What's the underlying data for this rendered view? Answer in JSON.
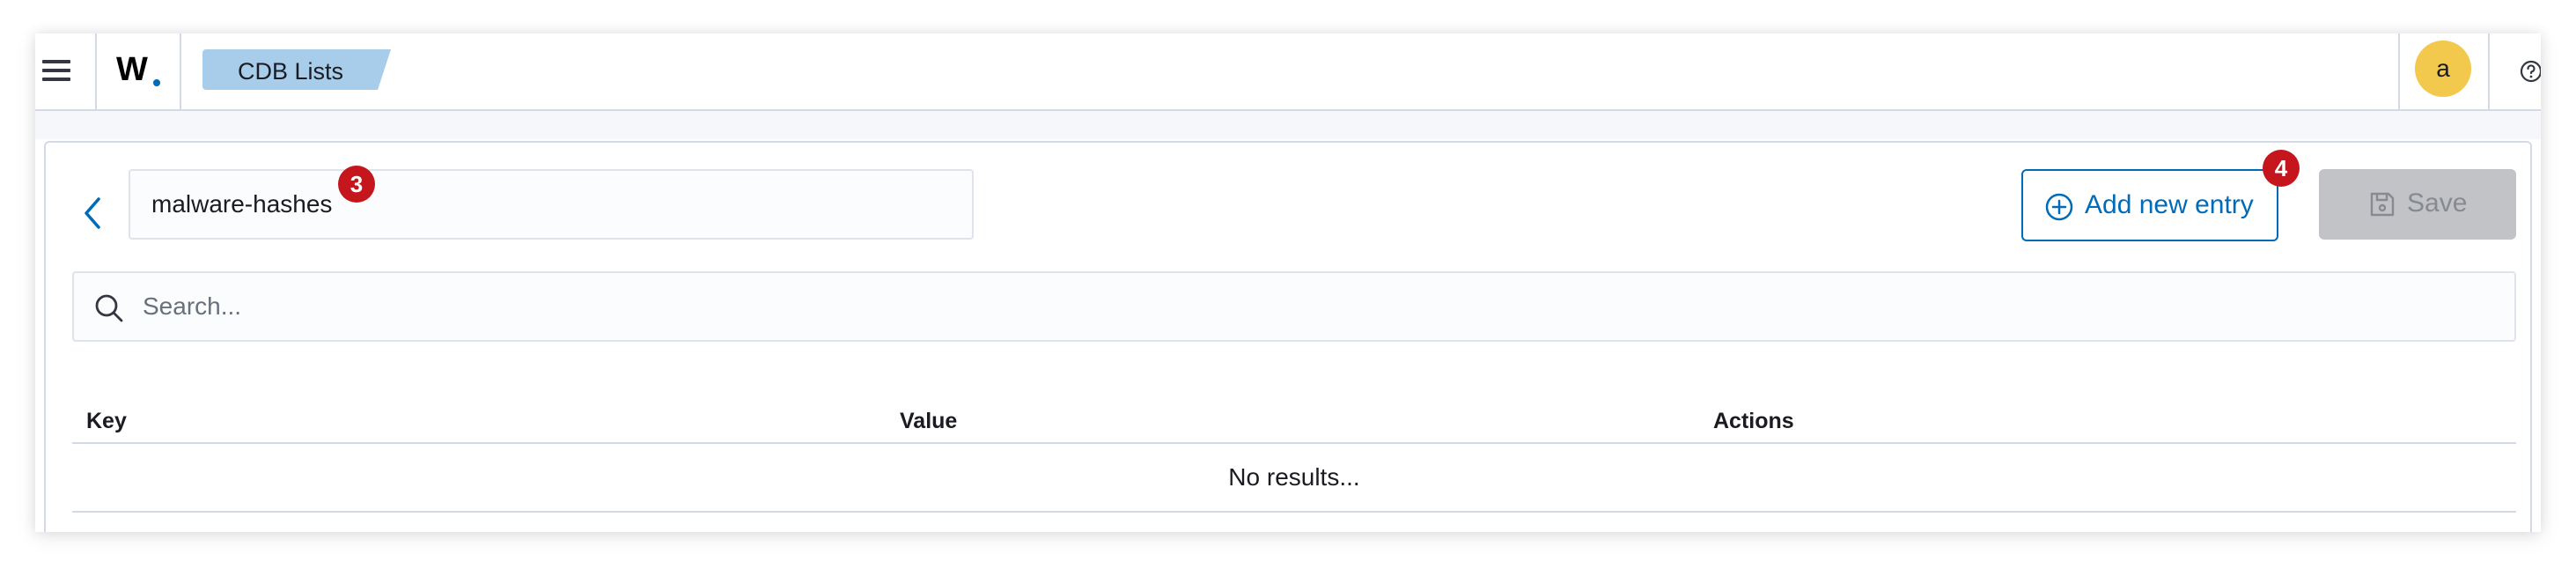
{
  "header": {
    "logo_text": "W",
    "breadcrumb": "CDB Lists",
    "avatar_initial": "a"
  },
  "editor": {
    "list_name": "malware-hashes",
    "name_badge": "3",
    "add_button_label": "Add new entry",
    "add_badge": "4",
    "save_button_label": "Save"
  },
  "search": {
    "placeholder": "Search..."
  },
  "table": {
    "columns": [
      "Key",
      "Value",
      "Actions"
    ],
    "empty_message": "No results..."
  },
  "colors": {
    "accent": "#006bb8",
    "breadcrumb_bg": "#a8cdea",
    "avatar_bg": "#f2c94c",
    "badge_bg": "#c4161c",
    "disabled_button_bg": "#c2c3c6"
  },
  "icons": [
    "menu-icon",
    "help-icon",
    "chevron-left-icon",
    "plus-circle-icon",
    "save-icon",
    "search-icon"
  ]
}
